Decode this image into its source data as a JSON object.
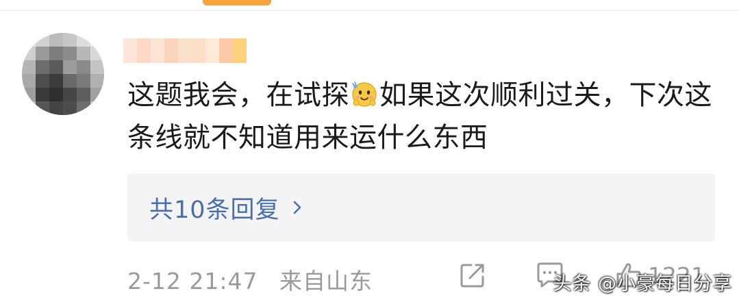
{
  "comment": {
    "text_before_emoji": "这题我会，在试探",
    "emoji_icon": "smiling-face-with-sweat-emoji",
    "text_after_emoji": "如果这次顺利过关，下次这条线就不知道用来运什么东西"
  },
  "replies": {
    "label": "共10条回复",
    "chevron_icon": "chevron-right-icon"
  },
  "meta": {
    "time": "2-12 21:47",
    "location": "来自山东"
  },
  "actions": {
    "share_icon": "share-icon",
    "comment_icon": "comment-icon",
    "like_icon": "thumbs-up-icon",
    "like_count": "1221"
  },
  "watermark": "头条 @小豪每日分享",
  "colors": {
    "accent": "#f3a43a",
    "link": "#4b6ea8",
    "muted": "#9a9a9a",
    "reply_bg": "#f4f4f6"
  }
}
